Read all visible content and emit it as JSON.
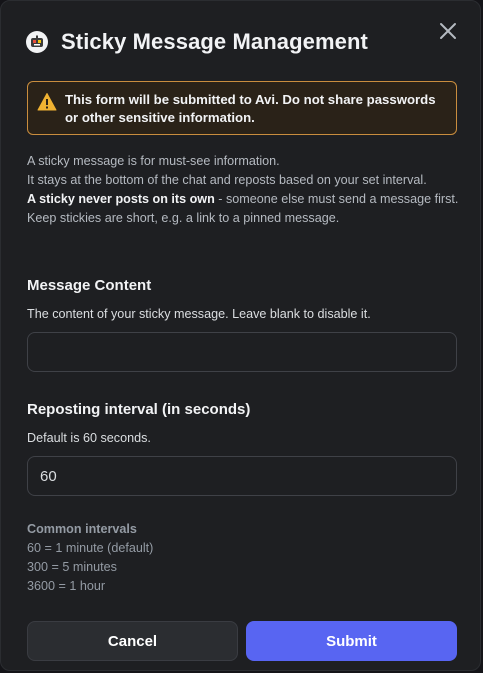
{
  "modal": {
    "title": "Sticky Message Management",
    "close_icon": "close-icon",
    "app_icon": "bot-avatar-icon"
  },
  "warning": {
    "icon": "warning-icon",
    "prefix": "This form will be submitted to ",
    "bot_name": "Avi",
    "suffix": ". Do not share passwords or other sensitive information."
  },
  "description": {
    "line1": "A sticky message is for must-see information.",
    "line2": "It stays at the bottom of the chat and reposts based on your set interval.",
    "line3_bold": "A sticky never posts on its own",
    "line3_rest": " - someone else must send a message first.",
    "line4": "Keep stickies are short, e.g. a link to a pinned message."
  },
  "message_content": {
    "label": "Message Content",
    "hint": "The content of your sticky message. Leave blank to disable it.",
    "value": "",
    "placeholder": ""
  },
  "interval": {
    "label": "Reposting interval (in seconds)",
    "hint": "Default is 60 seconds.",
    "value": "60"
  },
  "common_intervals": {
    "heading": "Common intervals",
    "items": [
      "60 = 1 minute (default)",
      "300 = 5 minutes",
      "3600 = 1 hour"
    ]
  },
  "buttons": {
    "cancel": "Cancel",
    "submit": "Submit"
  },
  "colors": {
    "accent": "#5865f2",
    "warning_border": "#c98d3e",
    "warning_icon": "#f0b232"
  }
}
